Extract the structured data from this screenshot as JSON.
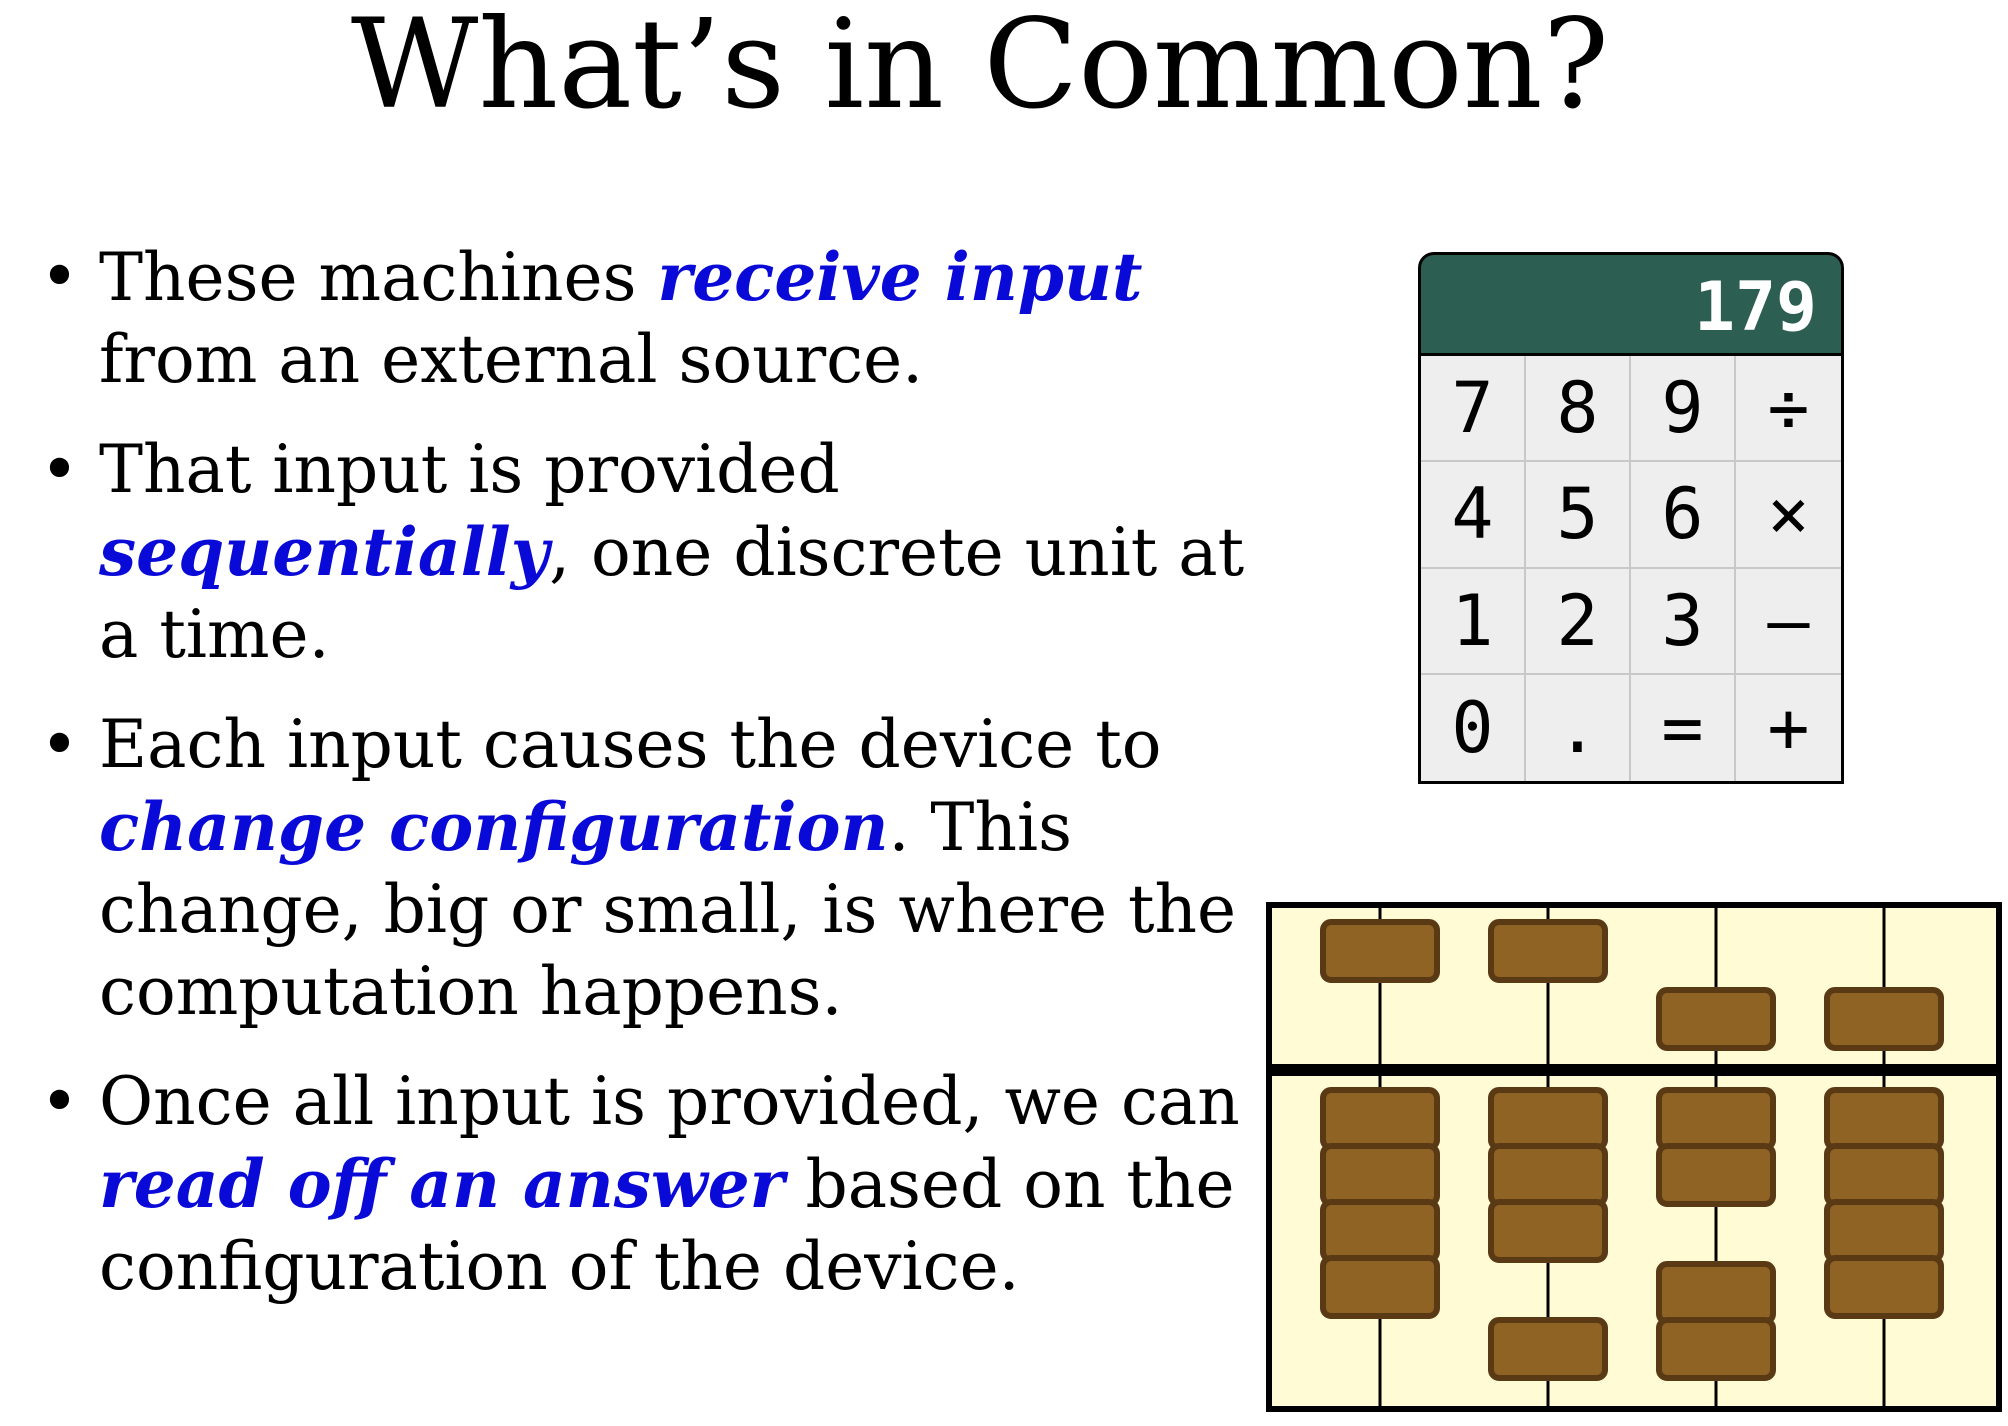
{
  "slide": {
    "title": "What’s in Common?",
    "bullets": [
      {
        "parts": [
          {
            "text": "These machines ",
            "em": false
          },
          {
            "text": "receive input",
            "em": true
          },
          {
            "text": " from an external source.",
            "em": false
          }
        ]
      },
      {
        "parts": [
          {
            "text": "That input is provided ",
            "em": false
          },
          {
            "text": "sequentially",
            "em": true
          },
          {
            "text": ", one discrete unit at a time.",
            "em": false
          }
        ]
      },
      {
        "parts": [
          {
            "text": "Each input causes the device to ",
            "em": false
          },
          {
            "text": "change configuration",
            "em": true
          },
          {
            "text": ". This change, big or small, is where the computation happens.",
            "em": false
          }
        ]
      },
      {
        "parts": [
          {
            "text": "Once all input is provided, we can ",
            "em": false
          },
          {
            "text": "read off an answer",
            "em": true
          },
          {
            "text": " based on the configuration of the device.",
            "em": false
          }
        ]
      }
    ]
  },
  "calculator": {
    "display": "179",
    "keys": [
      "7",
      "8",
      "9",
      "÷",
      "4",
      "5",
      "6",
      "×",
      "1",
      "2",
      "3",
      "–",
      "0",
      ".",
      "=",
      "+"
    ],
    "display_color": "#2d5e52"
  },
  "abacus": {
    "rods": [
      {
        "upper_active": false,
        "lower_active": 4
      },
      {
        "upper_active": false,
        "lower_active": 3
      },
      {
        "upper_active": true,
        "lower_active": 2
      },
      {
        "upper_active": true,
        "lower_active": 4
      }
    ],
    "frame_color": "#fffcd5",
    "bead_color": "#8e6324",
    "bead_border_color": "#5a3a14"
  },
  "colors": {
    "highlight": "#0a0ad8"
  }
}
